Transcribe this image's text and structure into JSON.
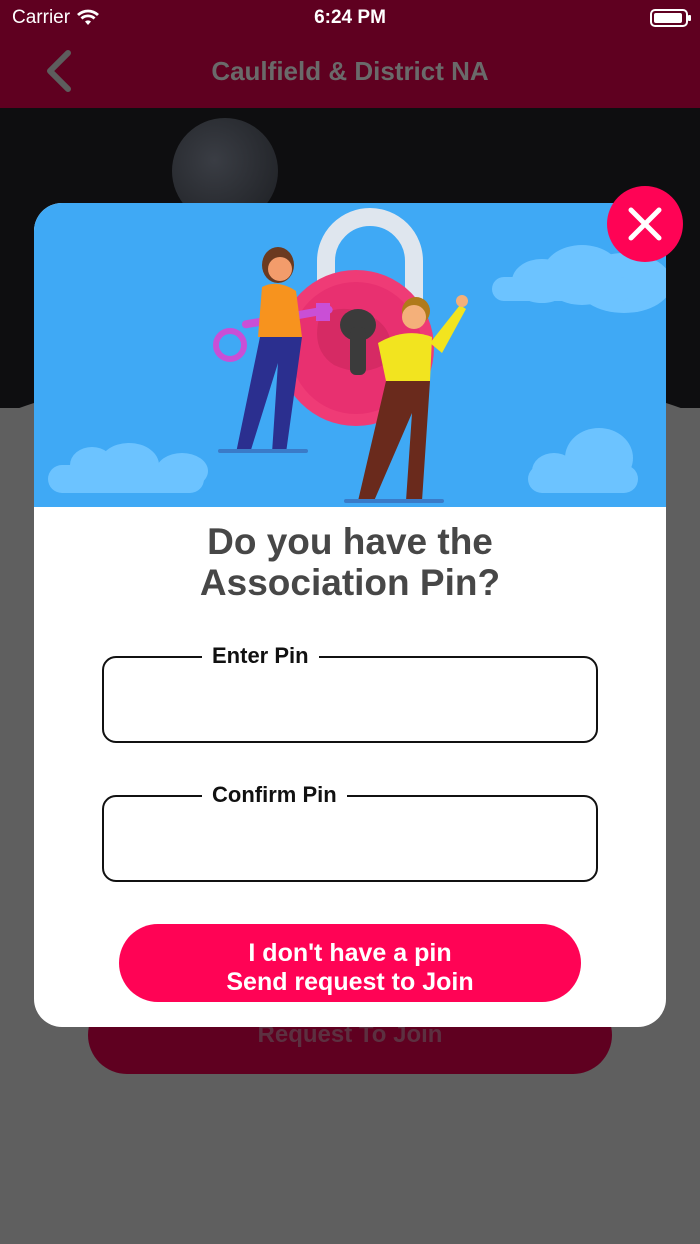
{
  "status_bar": {
    "carrier": "Carrier",
    "time": "6:24 PM"
  },
  "nav": {
    "title": "Caulfield & District NA",
    "back_icon": "chevron-left-icon"
  },
  "background": {
    "join_button_label": "Request To Join"
  },
  "modal": {
    "heading_line1": "Do you have the",
    "heading_line2": "Association Pin?",
    "pin_label": "Enter Pin",
    "pin_value": "",
    "confirm_label": "Confirm Pin",
    "confirm_value": "",
    "cta_line1": "I don't have a pin",
    "cta_line2": "Send request to Join",
    "close_icon": "close-icon",
    "illustration": "padlock-key-people-illustration"
  },
  "colors": {
    "brand_dark": "#5f0020",
    "accent_pink": "#ff0355",
    "sky_blue": "#3fa9f5",
    "overlay": "#5f5f5f"
  }
}
